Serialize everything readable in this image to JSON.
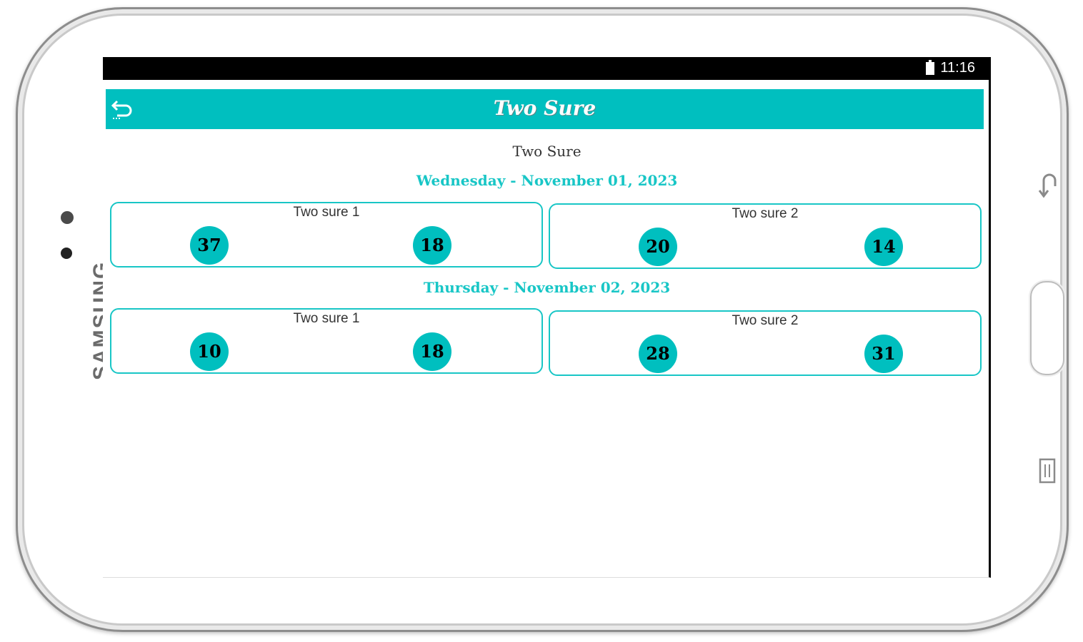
{
  "device": {
    "brand": "SAMSUNG"
  },
  "status_bar": {
    "time": "11:16"
  },
  "app_bar": {
    "title": "Two Sure"
  },
  "page": {
    "heading": "Two Sure",
    "days": [
      {
        "label": "Wednesday - November 01, 2023",
        "cards": [
          {
            "title": "Two sure 1",
            "numbers": [
              "37",
              "18"
            ]
          },
          {
            "title": "Two sure 2",
            "numbers": [
              "20",
              "14"
            ]
          }
        ]
      },
      {
        "label": "Thursday - November 02, 2023",
        "cards": [
          {
            "title": "Two sure 1",
            "numbers": [
              "10",
              "18"
            ]
          },
          {
            "title": "Two sure 2",
            "numbers": [
              "28",
              "31"
            ]
          }
        ]
      }
    ]
  },
  "colors": {
    "accent": "#00bfbf",
    "label_accent": "#18c6c6",
    "status_bar": "#000000"
  }
}
